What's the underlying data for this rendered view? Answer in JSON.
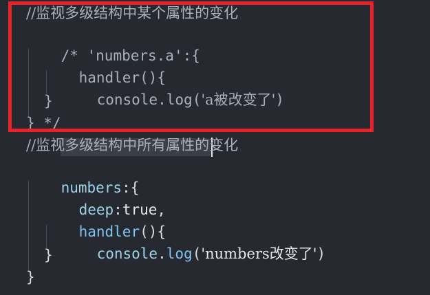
{
  "colors": {
    "background": "#262a30",
    "highlight_box": "#e8212a"
  },
  "code": {
    "line1": "//监视多级结构中某个属性的变化",
    "line2_open": "/* ",
    "line2_key": "'numbers.a'",
    "line2_rest": ":{",
    "line3_fn": "handler",
    "line3_rest": "(){",
    "line4_obj": "console",
    "line4_dot": ".",
    "line4_fn": "log",
    "line4_open": "(",
    "line4_str": "'a被改变了'",
    "line4_close": ")",
    "line5": "}",
    "line6": "} */",
    "line7": "//监视多级结构中所有属性的变化",
    "line8_key": "numbers",
    "line8_rest": ":{",
    "line9_key": "deep",
    "line9_colon": ":",
    "line9_val": "true",
    "line9_comma": ",",
    "line10_fn": "handler",
    "line10_rest": "(){",
    "line11_obj": "console",
    "line11_dot": ".",
    "line11_fn": "log",
    "line11_open": "(",
    "line11_str": "'numbers改变了'",
    "line11_close": ")",
    "line12": "}",
    "line13": "}"
  }
}
